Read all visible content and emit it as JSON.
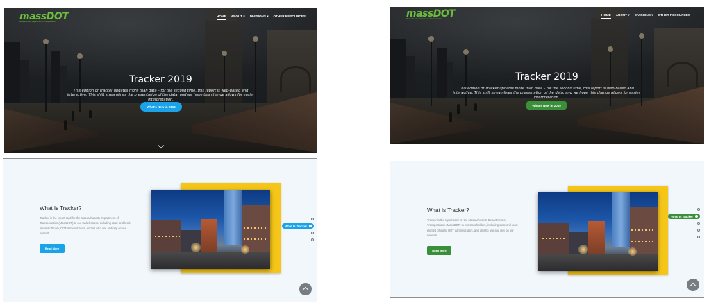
{
  "variants": [
    {
      "id": "left",
      "accent": "#1aa3e8",
      "logo": {
        "main": "massDOT",
        "sub": "Massachusetts Department of Transportation"
      },
      "nav": [
        {
          "label": "HOME",
          "active": true
        },
        {
          "label": "ABOUT ▾",
          "active": false
        },
        {
          "label": "DIVISIONS ▾",
          "active": false
        },
        {
          "label": "OTHER RESOURCES",
          "active": false
        }
      ],
      "hero": {
        "title": "Tracker 2019",
        "description": "This edition of Tracker updates more than data – for the second time, this report is web-based and interactive. This shift streamlines the presentation of the data, and we hope this change allows for easier interpretation.",
        "button": "What's New in 2019",
        "show_scroll_chevron": true
      },
      "section": {
        "title": "What Is Tracker?",
        "text": "Tracker is the report card for the Massachusetts Department of Transportation (MassDOT) to our stakeholders, including state and local elected officials, DOT administrators, and all who use and rely on our network.",
        "button": "Read More",
        "active_dot_label": "What Is Tracker",
        "dots_before": 1,
        "dots_after": 2
      }
    },
    {
      "id": "right",
      "accent": "#3a8f3a",
      "logo": {
        "main": "massDOT",
        "sub": "Massachusetts Department of Transportation"
      },
      "nav": [
        {
          "label": "HOME",
          "active": true
        },
        {
          "label": "ABOUT ▾",
          "active": false
        },
        {
          "label": "DIVISIONS ▾",
          "active": false
        },
        {
          "label": "OTHER RESOURCES",
          "active": false
        }
      ],
      "hero": {
        "title": "Tracker 2019",
        "description": "This edition of Tracker updates more than data – for the second time, this report is web-based and interactive. This shift streamlines the presentation of the data, and we hope this change allows for easier interpretation.",
        "button": "What's New in 2019",
        "show_scroll_chevron": false
      },
      "section": {
        "title": "What Is Tracker?",
        "text": "Tracker is the report card for the Massachusetts Department of Transportation (MassDOT) to our stakeholders, including state and local elected officials, DOT administrators, and all who use and rely on our network.",
        "button": "Read More",
        "active_dot_label": "What Is Tracker",
        "dots_before": 1,
        "dots_after": 3
      }
    }
  ]
}
